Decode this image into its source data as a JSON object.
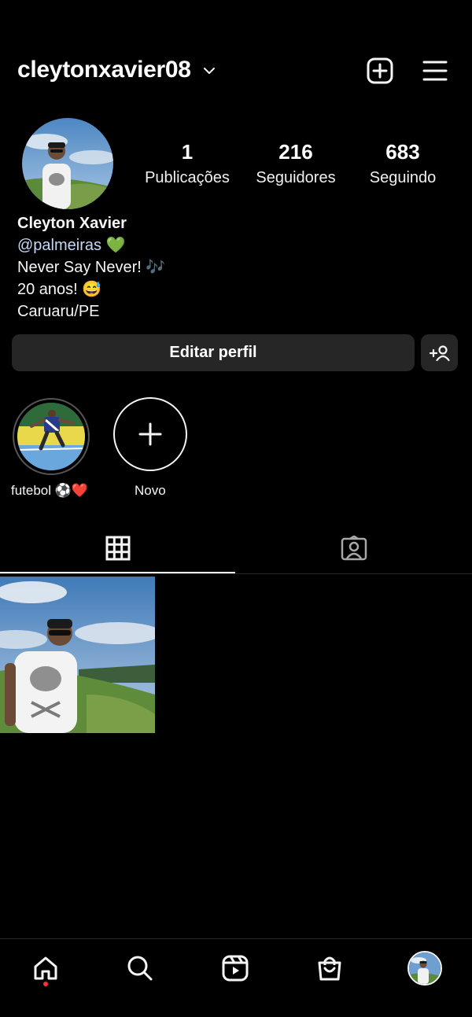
{
  "header": {
    "username": "cleytonxavier08",
    "icons": {
      "dropdown": "chevron-down-icon",
      "new_post": "plus-square-icon",
      "menu": "hamburger-menu-icon"
    }
  },
  "stats": [
    {
      "value": "1",
      "label": "Publicações"
    },
    {
      "value": "216",
      "label": "Seguidores"
    },
    {
      "value": "683",
      "label": "Seguindo"
    }
  ],
  "bio": {
    "name": "Cleyton Xavier",
    "mention": "@palmeiras",
    "mention_emoji": "💚",
    "line1": "Never Say Never! ",
    "line1_emoji": "🎶",
    "line2": "20 anos! ",
    "line2_emoji": "😅",
    "line3": "Caruaru/PE"
  },
  "actions": {
    "edit_profile": "Editar perfil",
    "discover_people_icon": "add-person-icon"
  },
  "highlights": [
    {
      "label": "futebol ⚽❤️"
    },
    {
      "label": "Novo"
    }
  ],
  "tabs": [
    {
      "icon": "grid-icon",
      "active": true
    },
    {
      "icon": "tagged-person-icon",
      "active": false
    }
  ],
  "bottom_nav": [
    {
      "icon": "home-icon",
      "notification": true
    },
    {
      "icon": "search-icon"
    },
    {
      "icon": "reels-icon"
    },
    {
      "icon": "shop-bag-icon"
    },
    {
      "icon": "profile-avatar-icon"
    }
  ],
  "colors": {
    "background": "#000000",
    "button_bg": "#262626",
    "mention": "#c5d8f6",
    "notify_dot": "#ff3040"
  }
}
